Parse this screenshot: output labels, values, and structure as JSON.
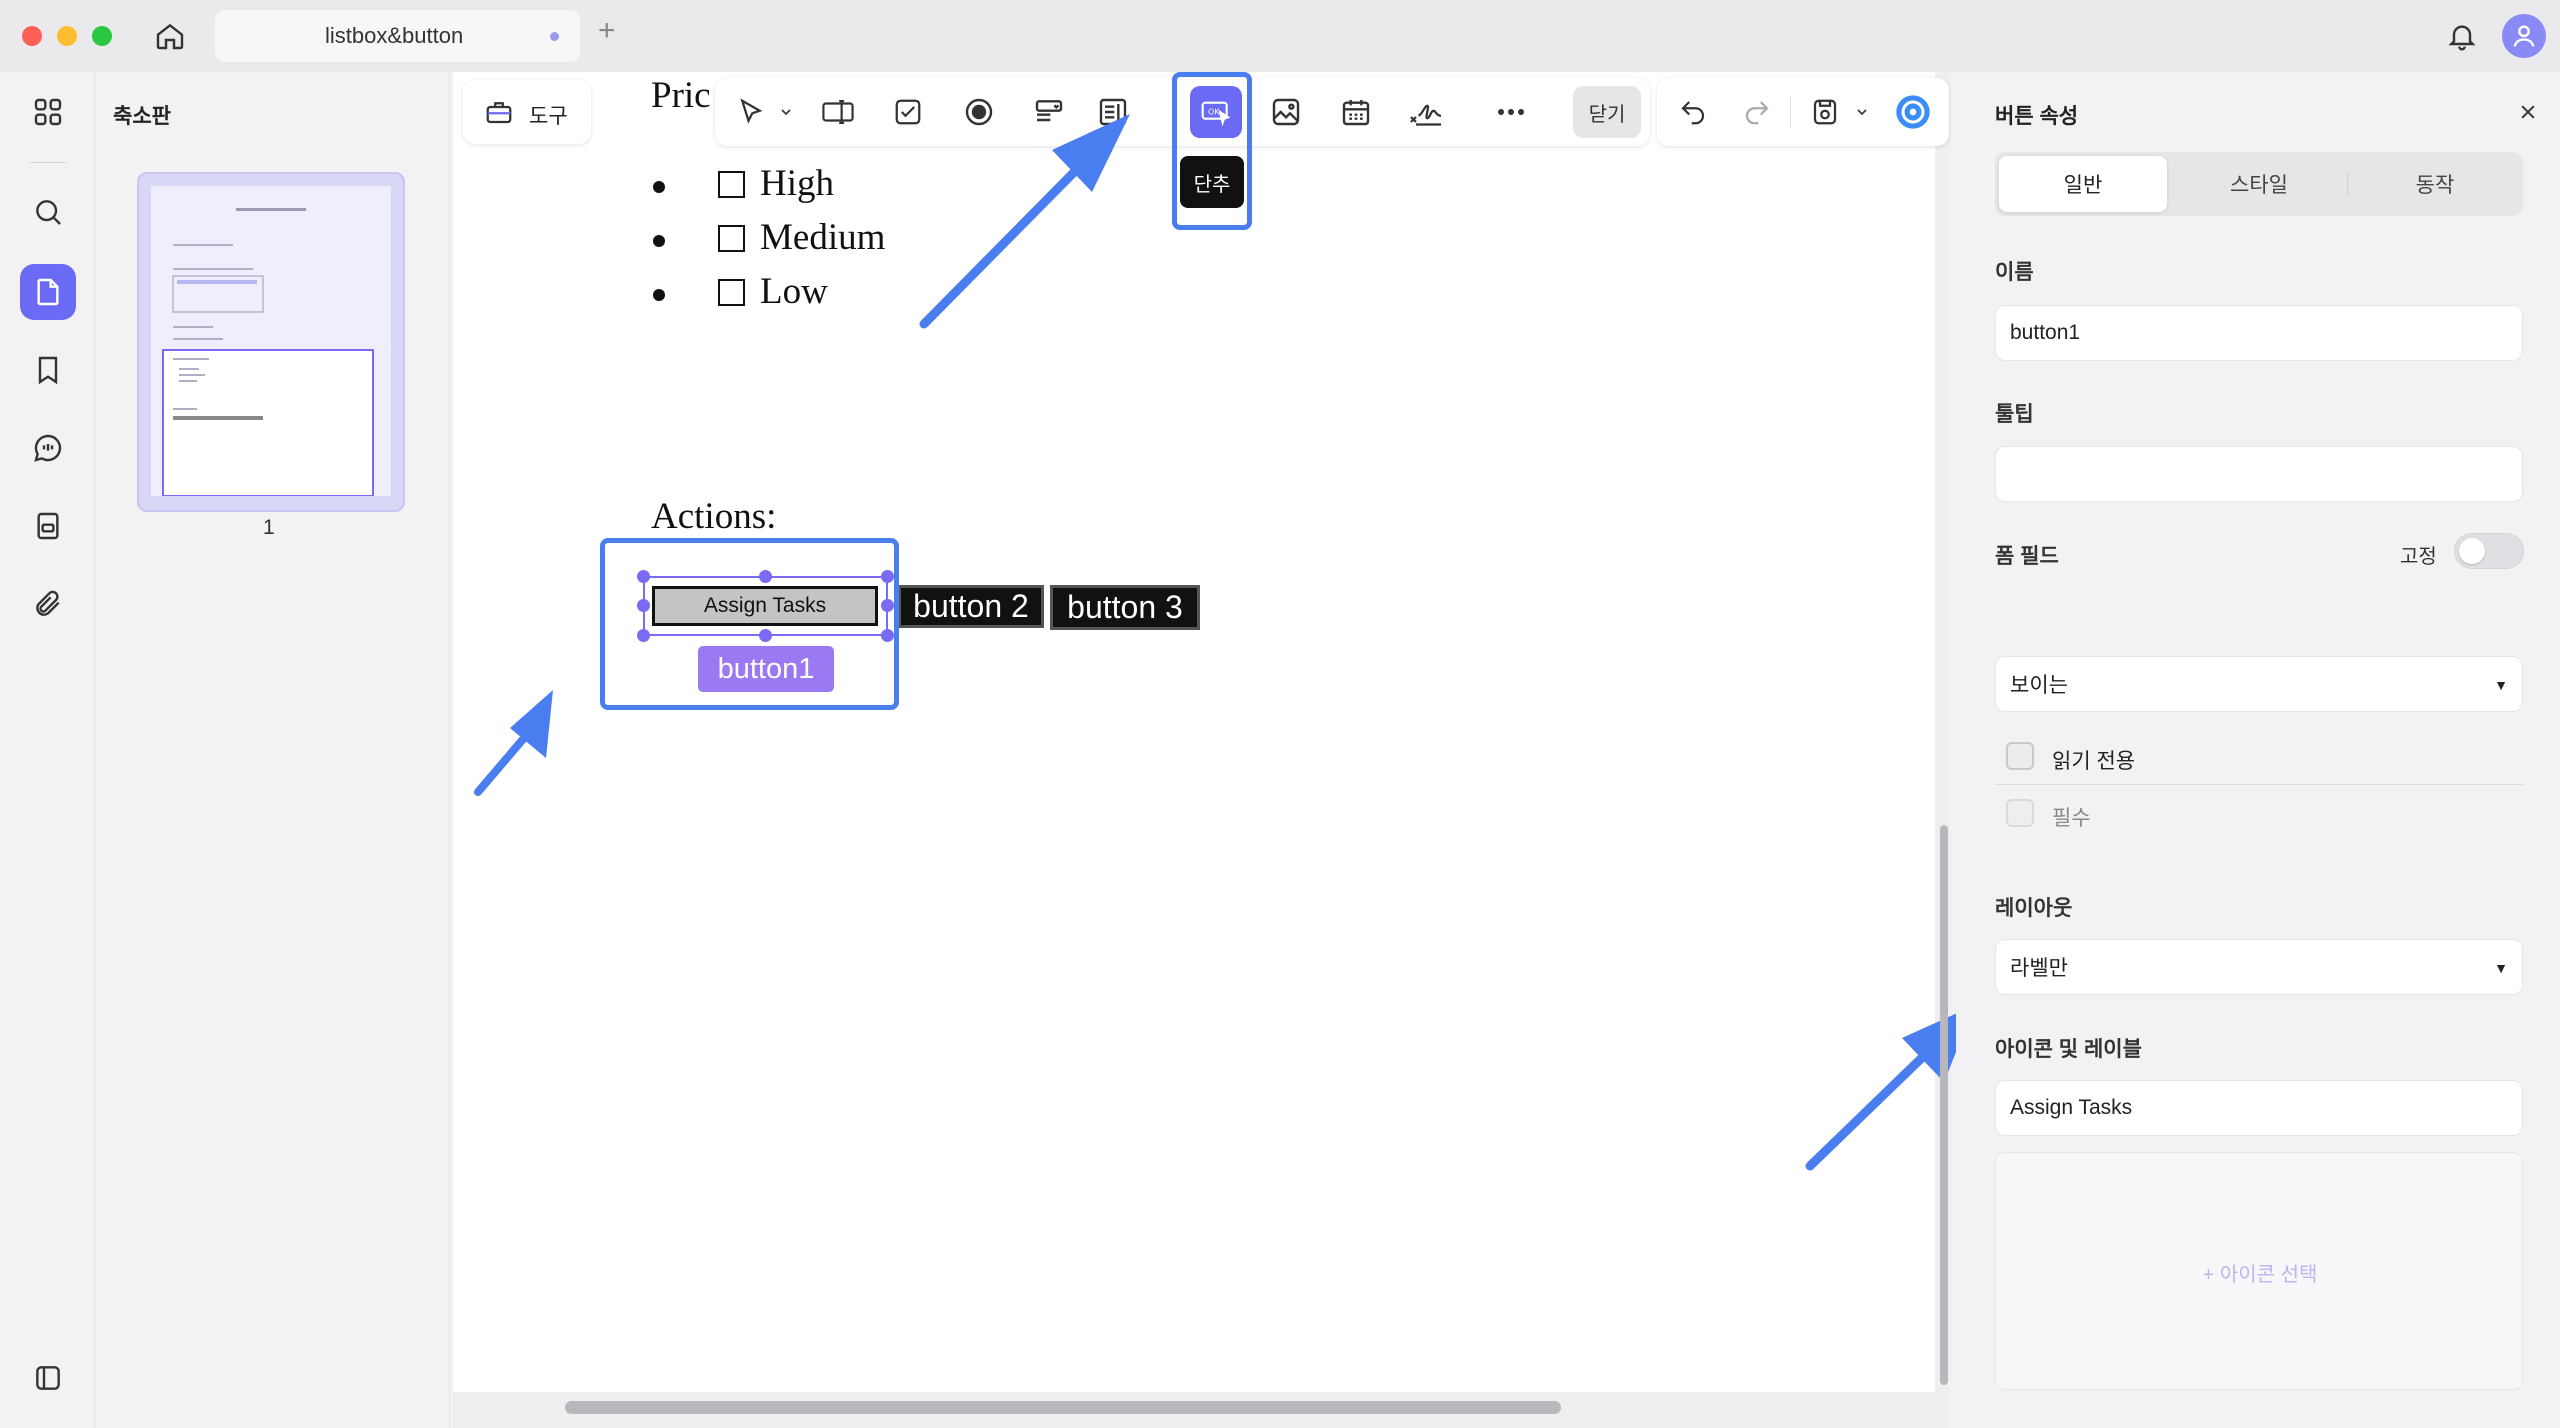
{
  "window": {
    "tab_title": "listbox&button",
    "new_tab": "+"
  },
  "thumbnails": {
    "title": "축소판",
    "pages": [
      {
        "number": "1"
      }
    ]
  },
  "toolbar": {
    "tools_label": "도구",
    "close_label": "닫기",
    "active_tooltip": "단추"
  },
  "document": {
    "heading_partial": "Pric",
    "priority_options": [
      "High",
      "Medium",
      "Low"
    ],
    "actions_label": "Actions:",
    "buttons": [
      {
        "label": "Assign Tasks"
      },
      {
        "label": "button 2"
      },
      {
        "label": "button 3"
      }
    ],
    "selected_field_name": "button1"
  },
  "properties": {
    "title": "버튼 속성",
    "tabs": [
      "일반",
      "스타일",
      "동작"
    ],
    "active_tab": 0,
    "name_label": "이름",
    "name_value": "button1",
    "tooltip_label": "툴팁",
    "tooltip_value": "",
    "form_field_label": "폼 필드",
    "lock_label": "고정",
    "lock_on": false,
    "visibility_value": "보이는",
    "readonly_label": "읽기 전용",
    "required_label": "필수",
    "layout_label": "레이아웃",
    "layout_value": "라벨만",
    "icon_label_section": "아이콘 및 레이블",
    "label_value": "Assign Tasks",
    "pick_icon": "+ 아이콘 선택"
  },
  "colors": {
    "accent": "#6a6af4",
    "annotation_blue": "#4a7df0",
    "selection_purple": "#9b79f2"
  }
}
